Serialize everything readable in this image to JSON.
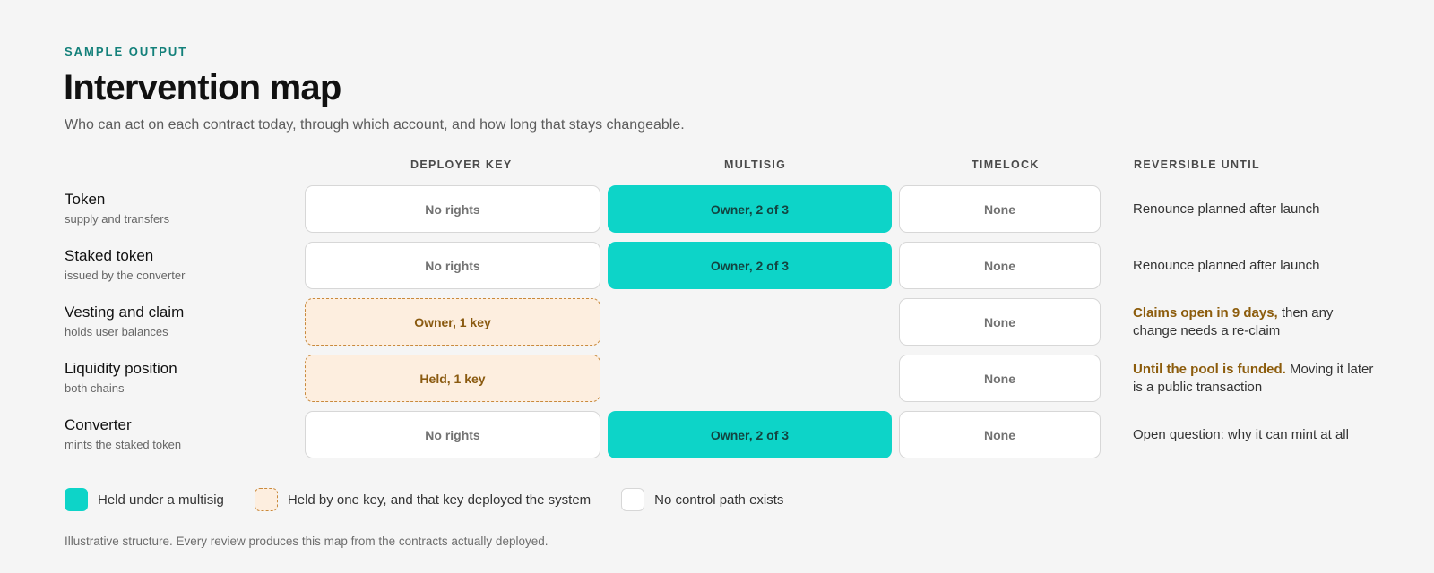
{
  "header": {
    "eyebrow": "SAMPLE OUTPUT",
    "title": "Intervention map",
    "subtitle": "Who can act on each contract today, through which account, and how long that stays changeable."
  },
  "columns": {
    "deployer": "DEPLOYER KEY",
    "multisig": "MULTISIG",
    "timelock": "TIMELOCK",
    "reversible": "REVERSIBLE UNTIL"
  },
  "rows": [
    {
      "name": "Token",
      "sub": "supply and transfers",
      "deployer": {
        "state": "none",
        "label": "No rights"
      },
      "multisig": {
        "state": "multi",
        "label": "Owner, 2 of 3"
      },
      "timelock": {
        "state": "none",
        "label": "None"
      },
      "reversible": {
        "emph": "",
        "text": "Renounce planned after launch"
      }
    },
    {
      "name": "Staked token",
      "sub": "issued by the converter",
      "deployer": {
        "state": "none",
        "label": "No rights"
      },
      "multisig": {
        "state": "multi",
        "label": "Owner, 2 of 3"
      },
      "timelock": {
        "state": "none",
        "label": "None"
      },
      "reversible": {
        "emph": "",
        "text": "Renounce planned after launch"
      }
    },
    {
      "name": "Vesting and claim",
      "sub": "holds user balances",
      "deployer": {
        "state": "key",
        "label": "Owner, 1 key"
      },
      "multisig": {
        "state": "empty",
        "label": ""
      },
      "timelock": {
        "state": "none",
        "label": "None"
      },
      "reversible": {
        "emph": "Claims open in 9 days,",
        "text": "then any change needs a re-claim"
      }
    },
    {
      "name": "Liquidity position",
      "sub": "both chains",
      "deployer": {
        "state": "key",
        "label": "Held, 1 key"
      },
      "multisig": {
        "state": "empty",
        "label": ""
      },
      "timelock": {
        "state": "none",
        "label": "None"
      },
      "reversible": {
        "emph": "Until the pool is funded.",
        "text": "Moving it later is a public transaction"
      }
    },
    {
      "name": "Converter",
      "sub": "mints the staked token",
      "deployer": {
        "state": "none",
        "label": "No rights"
      },
      "multisig": {
        "state": "multi",
        "label": "Owner, 2 of 3"
      },
      "timelock": {
        "state": "none",
        "label": "None"
      },
      "reversible": {
        "emph": "",
        "text": "Open question: why it can mint at all"
      }
    }
  ],
  "legend": [
    {
      "kind": "multi",
      "label": "Held under a multisig"
    },
    {
      "kind": "key",
      "label": "Held by one key, and that key deployed the system"
    },
    {
      "kind": "none",
      "label": "No control path exists"
    }
  ],
  "footnote": "Illustrative structure. Every review produces this map from the contracts actually deployed.",
  "colors": {
    "accent": "#13807a",
    "multisig": "#0dd4c8",
    "single_key_fill": "#fdeedf",
    "single_key_text": "#8a5a10",
    "emphasis": "#8c5c0c"
  }
}
